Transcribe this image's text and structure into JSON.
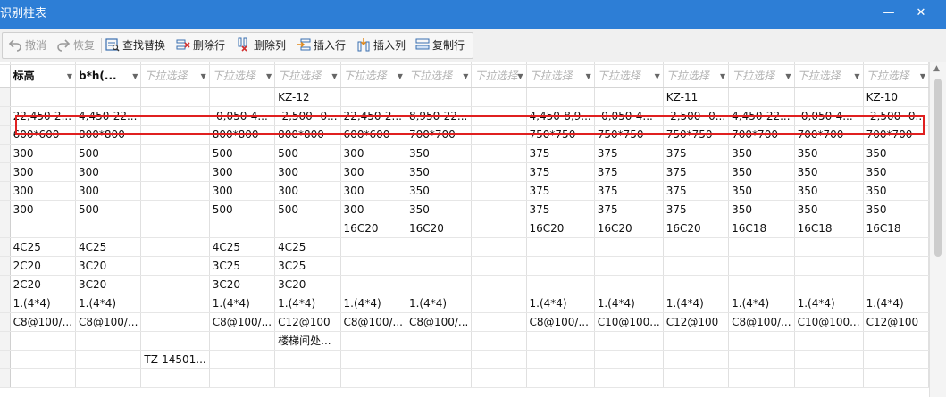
{
  "window": {
    "title": "识别柱表",
    "minimize_glyph": "—",
    "close_glyph": "✕"
  },
  "toolbar": {
    "undo": "撤消",
    "redo": "恢复",
    "find_replace": "查找替换",
    "delete_row": "删除行",
    "delete_col": "删除列",
    "insert_row": "插入行",
    "insert_col": "插入列",
    "copy_row": "复制行"
  },
  "grid": {
    "dropdown_arrow": "▼",
    "headers": [
      "标高",
      "b*h(...",
      "下拉选择",
      "下拉选择",
      "下拉选择",
      "下拉选择",
      "下拉选择",
      "下拉选择",
      "下拉选择",
      "下拉选择",
      "下拉选择",
      "下拉选择",
      "下拉选择",
      "下拉选择"
    ],
    "header_placeholder": [
      false,
      false,
      true,
      true,
      true,
      true,
      true,
      true,
      true,
      true,
      true,
      true,
      true,
      true
    ],
    "rows": [
      [
        "",
        "",
        "",
        "",
        "KZ-12",
        "",
        "",
        "",
        "",
        "",
        "KZ-11",
        "",
        "",
        "KZ-10"
      ],
      [
        "22,450-2...",
        "4,450-22...",
        "",
        "-0,050-4...",
        "-2,500--0...",
        "22,450-2...",
        "8,950-22...",
        "",
        "4,450-8,9...",
        "-0,050-4...",
        "-2,500--0...",
        "4,450-22...",
        "-0,050-4...",
        "-2,500--0..."
      ],
      [
        "600*600",
        "800*800",
        "",
        "800*800",
        "800*800",
        "600*600",
        "700*700",
        "",
        "750*750",
        "750*750",
        "750*750",
        "700*700",
        "700*700",
        "700*700"
      ],
      [
        "300",
        "500",
        "",
        "500",
        "500",
        "300",
        "350",
        "",
        "375",
        "375",
        "375",
        "350",
        "350",
        "350"
      ],
      [
        "300",
        "300",
        "",
        "300",
        "300",
        "300",
        "350",
        "",
        "375",
        "375",
        "375",
        "350",
        "350",
        "350"
      ],
      [
        "300",
        "300",
        "",
        "300",
        "300",
        "300",
        "350",
        "",
        "375",
        "375",
        "375",
        "350",
        "350",
        "350"
      ],
      [
        "300",
        "500",
        "",
        "500",
        "500",
        "300",
        "350",
        "",
        "375",
        "375",
        "375",
        "350",
        "350",
        "350"
      ],
      [
        "",
        "",
        "",
        "",
        "",
        "16C20",
        "16C20",
        "",
        "16C20",
        "16C20",
        "16C20",
        "16C18",
        "16C18",
        "16C18"
      ],
      [
        "4C25",
        "4C25",
        "",
        "4C25",
        "4C25",
        "",
        "",
        "",
        "",
        "",
        "",
        "",
        "",
        ""
      ],
      [
        "2C20",
        "3C20",
        "",
        "3C25",
        "3C25",
        "",
        "",
        "",
        "",
        "",
        "",
        "",
        "",
        ""
      ],
      [
        "2C20",
        "3C20",
        "",
        "3C20",
        "3C20",
        "",
        "",
        "",
        "",
        "",
        "",
        "",
        "",
        ""
      ],
      [
        "1.(4*4)",
        "1.(4*4)",
        "",
        "1.(4*4)",
        "1.(4*4)",
        "1.(4*4)",
        "1.(4*4)",
        "",
        "1.(4*4)",
        "1.(4*4)",
        "1.(4*4)",
        "1.(4*4)",
        "1.(4*4)",
        "1.(4*4)"
      ],
      [
        "C8@100/...",
        "C8@100/...",
        "",
        "C8@100/...",
        "C12@100",
        "C8@100/...",
        "C8@100/...",
        "",
        "C8@100/...",
        "C10@100...",
        "C12@100",
        "C8@100/...",
        "C10@100...",
        "C12@100"
      ],
      [
        "",
        "",
        "",
        "",
        "楼梯间处...",
        "",
        "",
        "",
        "",
        "",
        "",
        "",
        "",
        ""
      ],
      [
        "",
        "",
        "TZ-14501...",
        "",
        "",
        "",
        "",
        "",
        "",
        "",
        "",
        "",
        "",
        ""
      ],
      [
        "",
        "",
        "",
        "",
        "",
        "",
        "",
        "",
        "",
        "",
        "",
        "",
        "",
        ""
      ]
    ],
    "highlighted_row_index": 1
  },
  "colors": {
    "titlebar": "#2d7ed6",
    "highlight": "#e02020"
  }
}
